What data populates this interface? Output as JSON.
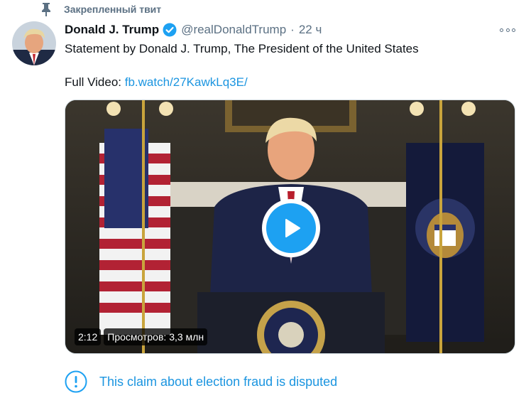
{
  "pinned": {
    "label": "Закрепленный твит",
    "icon": "pin-icon"
  },
  "author": {
    "name": "Donald J. Trump",
    "handle": "@realDonaldTrump",
    "separator": "·",
    "time": "22 ч",
    "verified_icon": "verified-badge-icon"
  },
  "tweet": {
    "text": "Statement by Donald J. Trump, The President of the United States",
    "video_prefix": "Full Video: ",
    "video_link": "fb.watch/27KawkLq3E/"
  },
  "media": {
    "duration": "2:12",
    "views": "Просмотров: 3,3 млн",
    "play_icon": "play-icon"
  },
  "disputed": {
    "text": "This claim about election fraud is disputed",
    "icon": "info-circle-icon"
  },
  "colors": {
    "accent": "#1da1f2",
    "link": "#1b95e0",
    "secondary_text": "#5b7083",
    "primary_text": "#0f1419"
  }
}
